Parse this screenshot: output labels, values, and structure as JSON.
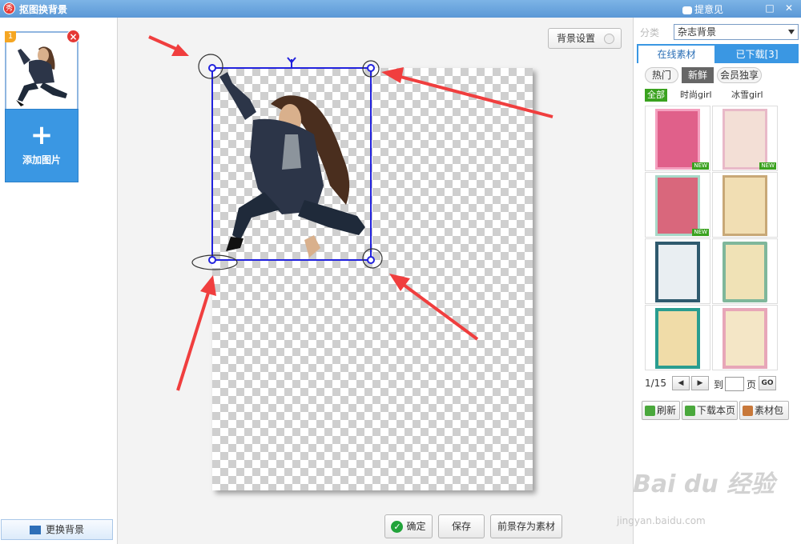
{
  "app": {
    "title": "抠图换背景",
    "logo": "秀",
    "feedback": "提意见"
  },
  "window": {
    "restore_icon": "□",
    "close_icon": "✕"
  },
  "left": {
    "thumb_badge": "1",
    "add_label": "添加图片",
    "change_bg_label": "更换背景"
  },
  "canvas": {
    "bg_settings_label": "背景设置"
  },
  "bottom": {
    "confirm": "确定",
    "save": "保存",
    "save_fg": "前景存为素材"
  },
  "right": {
    "category_label": "分类",
    "category_value": "杂志背景",
    "tabs": [
      "在线素材",
      "已下载[3]"
    ],
    "filters": [
      "热门",
      "新鲜",
      "会员独享"
    ],
    "subfilters": [
      "全部",
      "时尚girl",
      "冰雪girl"
    ],
    "new_badge": "NEW",
    "pager": {
      "page": "1/15",
      "prev": "◀",
      "next": "▶",
      "to": "到",
      "page_unit": "页",
      "go": "GO"
    },
    "actions": [
      "刷新",
      "下载本页",
      "素材包"
    ]
  },
  "watermark": {
    "brand": "Bai du 经验",
    "url": "jingyan.baidu.com"
  },
  "colors": {
    "accent": "#3a97e3",
    "selection": "#2222dd",
    "arrow": "#f03e3e",
    "new": "#3aa21f"
  }
}
